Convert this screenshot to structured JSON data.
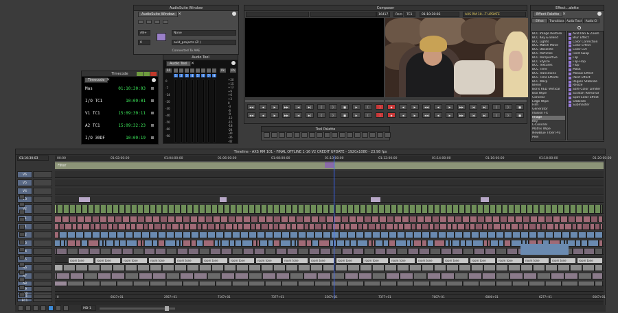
{
  "audiosuite": {
    "title": "AudioSuite Window",
    "tab": "AudioSuite Window",
    "track_value": "A8+",
    "plugin_value": "None",
    "volume_value": "avid_projects (Z:)",
    "status": "Connected To AAE",
    "small_field": "0"
  },
  "audio_tool": {
    "title": "Audio Tool",
    "tab": "Audio Tool",
    "left_scale": [
      "0",
      "-7",
      "-14",
      "-20",
      "-30",
      "-40",
      "-50",
      "-60",
      "-90"
    ],
    "right_scale": [
      "+20",
      "+15",
      "+12",
      "+9",
      "+6",
      "+3",
      "0",
      "-3",
      "-6",
      "-9",
      "-12",
      "-15",
      "-18",
      "-24",
      "-30",
      "-36",
      "-42"
    ],
    "top_labels": [
      "RP",
      "Pk",
      "Ph"
    ],
    "channels": [
      "1",
      "2",
      "3",
      "4",
      "5",
      "6",
      "7",
      "8"
    ]
  },
  "composer": {
    "title": "Composer",
    "left_tc": "16417",
    "mode": "Rem",
    "mode2": "TC1",
    "record_tc": "01:10:30:03",
    "sequence": "AXS RM 10...T UPDATE"
  },
  "timecode": {
    "title": "Timecode",
    "tab": "Timecode",
    "rows": [
      {
        "label": "Mas",
        "value": "01:10:30:03"
      },
      {
        "label": "I/O TC1",
        "value": "10:09:01"
      },
      {
        "label": "V1 TC1",
        "value": "15:09:39:11"
      },
      {
        "label": "A2 TC1",
        "value": "15:09:32:23"
      },
      {
        "label": "I/O 30DF",
        "value": "10:09:19"
      }
    ]
  },
  "tool_palette": {
    "title": "Tool Palette"
  },
  "effect_palette": {
    "title": "Effect...alette",
    "tab": "Effect Palette",
    "subtabs": [
      "Effect",
      "Transitions",
      "Audio Track",
      "Audio Cl"
    ],
    "categories": [
      "BCC Image Restore",
      "BCC Key & Blend",
      "BCC Lights",
      "BCC Match Move",
      "BCC Obsolete",
      "BCC Particles",
      "BCC Perspective",
      "BCC Stylize",
      "BCC Textures",
      "BCC Time",
      "BCC Transitions",
      "BCC Time Effects",
      "BCC Warp",
      "Blend",
      "Boris RED Vertical",
      "Box Wipe",
      "Conceal",
      "Edge Wipe",
      "Film",
      "Generator",
      "Illusion FX",
      "Image",
      "Key",
      "L-Conceal",
      "Matrix Wipe",
      "NewBlue Titler Pro",
      "Peel"
    ],
    "effects": [
      "Avid Pan & Zoom",
      "Blur Effect",
      "Color Correction",
      "Color Effect",
      "Color LUT",
      "Field Swap",
      "Flip",
      "Flip-Flop",
      "Flop",
      "Mask",
      "Mosaic Effect",
      "Paint Effect",
      "Region Stabilize",
      "Resize",
      "Safe Color Limiter",
      "Scratch Removal",
      "Spot Color Effect",
      "Stabilize",
      "Submaster"
    ]
  },
  "timeline": {
    "title": "Timeline - AXS RM 101 - FINAL OFFLINE 1-16 V2 CREDIT UPDATE - 1920x1080 - 23.98 fps",
    "current_tc": "01:10:30:03",
    "ruler": [
      "00:00",
      "01:02:00:00",
      "01:04:00:00",
      "01:06:00:00",
      "01:08:00:00",
      "01:10:00:00",
      "01:12:00:00",
      "01:14:00:00",
      "01:16:00:00",
      "01:18:00:00",
      "01:20:00:00"
    ],
    "tracks": [
      "V6",
      "V5",
      "V4",
      "V3",
      "V2",
      "V1",
      "A1",
      "A2",
      "A3",
      "A4",
      "A5",
      "A6",
      "A7",
      "A8",
      "A9",
      "A10",
      "TC1",
      "EC1"
    ],
    "filter_label": "Filter",
    "room_tone": "room tone",
    "bottom_tcs": [
      "0",
      "6027+01",
      "2957+01",
      "7167+01",
      "7377+01",
      "2567+01",
      "7377+01",
      "7607+01",
      "6800+01",
      "6277+01",
      "6667+01"
    ],
    "zoom_label": "MD-1"
  },
  "colors": {
    "accent": "#3fef5e",
    "video": "#8aa86a",
    "audio_red": "#a06a76",
    "audio_blue": "#6a8ab0",
    "track_label": "#5a6a86"
  }
}
